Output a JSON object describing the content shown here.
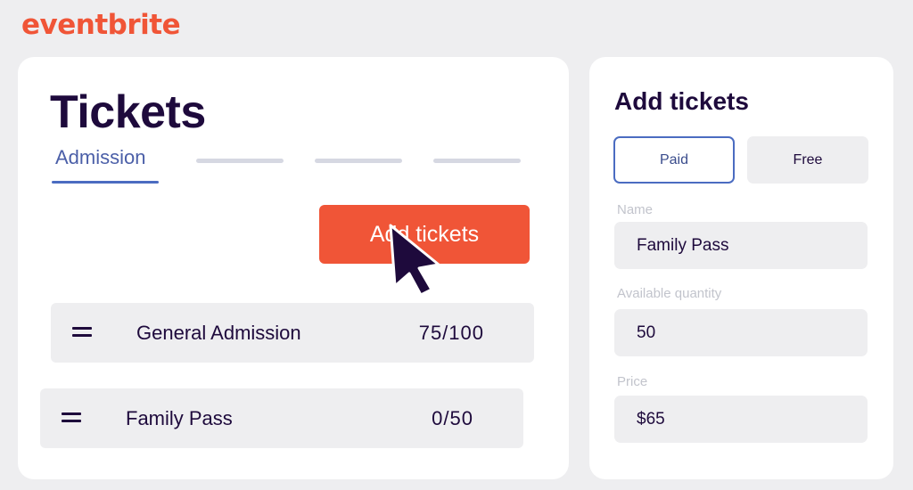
{
  "brand": {
    "logo_text": "eventbrite",
    "accent_color": "#f05537"
  },
  "tickets_panel": {
    "title": "Tickets",
    "tabs": [
      {
        "label": "Admission",
        "active": true
      }
    ],
    "add_button_label": "Add tickets",
    "rows": [
      {
        "name": "General Admission",
        "quantity": "75/100"
      },
      {
        "name": "Family Pass",
        "quantity": "0/50"
      }
    ]
  },
  "add_panel": {
    "title": "Add tickets",
    "type_options": {
      "paid": "Paid",
      "free": "Free",
      "selected": "Paid"
    },
    "fields": {
      "name": {
        "label": "Name",
        "value": "Family Pass"
      },
      "quantity": {
        "label": "Available quantity",
        "value": "50"
      },
      "price": {
        "label": "Price",
        "value": "$65"
      }
    }
  },
  "icons": {
    "cursor": "arrow-pointer-icon",
    "drag": "drag-handle-icon"
  }
}
